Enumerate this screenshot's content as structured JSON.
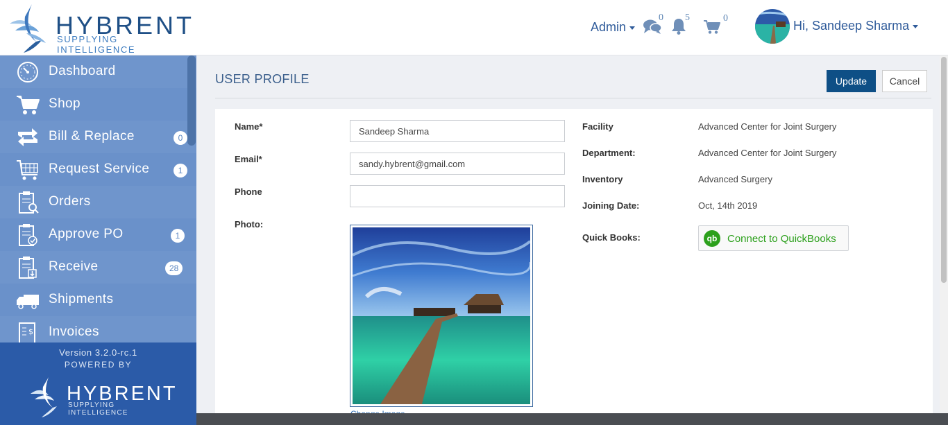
{
  "brand": {
    "name": "HYBRENT",
    "tagline": "SUPPLYING INTELLIGENCE"
  },
  "header": {
    "admin_label": "Admin",
    "messages_count": "0",
    "notifications_count": "5",
    "cart_count": "0",
    "greeting": "Hi, Sandeep Sharma"
  },
  "sidebar": {
    "items": [
      {
        "label": "Dashboard",
        "icon": "dashboard-gauge-icon",
        "badge": ""
      },
      {
        "label": "Shop",
        "icon": "shopping-cart-icon",
        "badge": ""
      },
      {
        "label": "Bill & Replace",
        "icon": "replace-arrows-icon",
        "badge": "0"
      },
      {
        "label": "Request Service",
        "icon": "service-cart-icon",
        "badge": "1"
      },
      {
        "label": "Orders",
        "icon": "orders-clipboard-icon",
        "badge": ""
      },
      {
        "label": "Approve PO",
        "icon": "approve-clipboard-icon",
        "badge": "1"
      },
      {
        "label": "Receive",
        "icon": "receive-clipboard-icon",
        "badge": "28"
      },
      {
        "label": "Shipments",
        "icon": "truck-icon",
        "badge": ""
      },
      {
        "label": "Invoices",
        "icon": "invoice-icon",
        "badge": ""
      }
    ],
    "version": "Version 3.2.0-rc.1",
    "powered_by": "POWERED BY"
  },
  "page": {
    "title": "USER PROFILE",
    "update_label": "Update",
    "cancel_label": "Cancel"
  },
  "form": {
    "name_label": "Name*",
    "name_value": "Sandeep Sharma",
    "email_label": "Email*",
    "email_value": "sandy.hybrent@gmail.com",
    "phone_label": "Phone",
    "phone_value": "",
    "photo_label": "Photo:",
    "change_link": "Change Image"
  },
  "info": {
    "facility_label": "Facility",
    "facility_value": "Advanced Center for Joint Surgery",
    "department_label": "Department:",
    "department_value": "Advanced Center for Joint Surgery",
    "inventory_label": "Inventory",
    "inventory_value": "Advanced Surgery",
    "joining_label": "Joining Date:",
    "joining_value": "Oct, 14th 2019",
    "quickbooks_label": "Quick Books:",
    "quickbooks_button": "Connect to QuickBooks",
    "quickbooks_logo": "qb"
  },
  "colors": {
    "sidebar": "#6f95cc",
    "sidebar_footer": "#2b5ba8",
    "primary_button": "#0e4f86",
    "quickbooks_green": "#2ca01c"
  }
}
